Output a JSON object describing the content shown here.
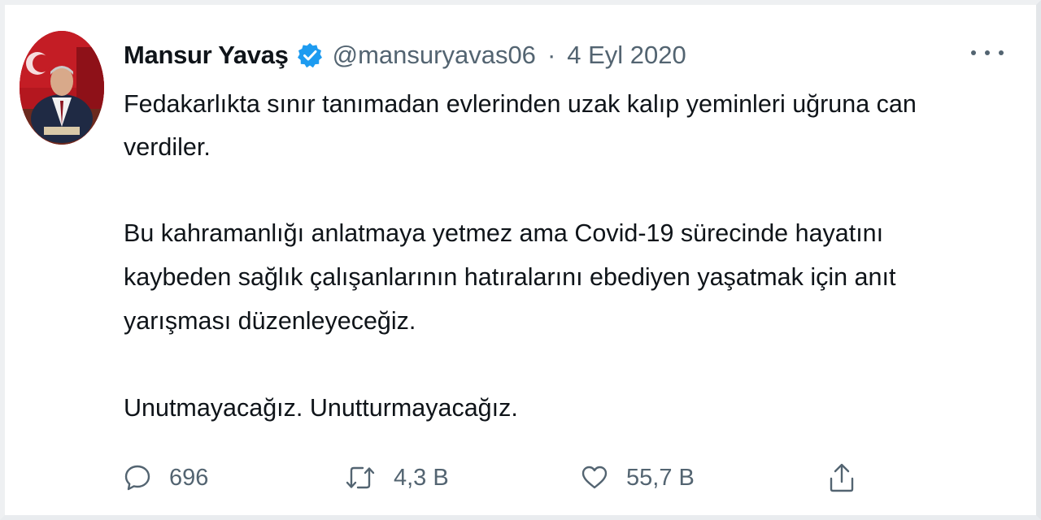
{
  "tweet": {
    "author_name": "Mansur Yavaş",
    "handle": "@mansuryavas06",
    "separator": "·",
    "date": "4 Eyl 2020",
    "lines": [
      "Fedakarlıkta sınır tanımadan evlerinden uzak kalıp yeminleri uğruna can",
      "verdiler.",
      "Bu kahramanlığı anlatmaya yetmez ama Covid-19 sürecinde hayatını",
      "kaybeden sağlık çalışanlarının hatıralarını ebediyen yaşatmak için anıt",
      "yarışması düzenleyeceğiz.",
      "Unutmayacağız. Unutturmayacağız."
    ],
    "actions": {
      "reply_count": "696",
      "retweet_count": "4,3 B",
      "like_count": "55,7 B"
    }
  },
  "icons": {
    "verified": "verified-badge-icon",
    "more": "more-options-icon",
    "reply": "reply-icon",
    "retweet": "retweet-icon",
    "like": "heart-icon",
    "share": "share-icon"
  },
  "colors": {
    "text": "#0f1419",
    "secondary": "#536471",
    "verified_blue": "#1d9bf0"
  }
}
